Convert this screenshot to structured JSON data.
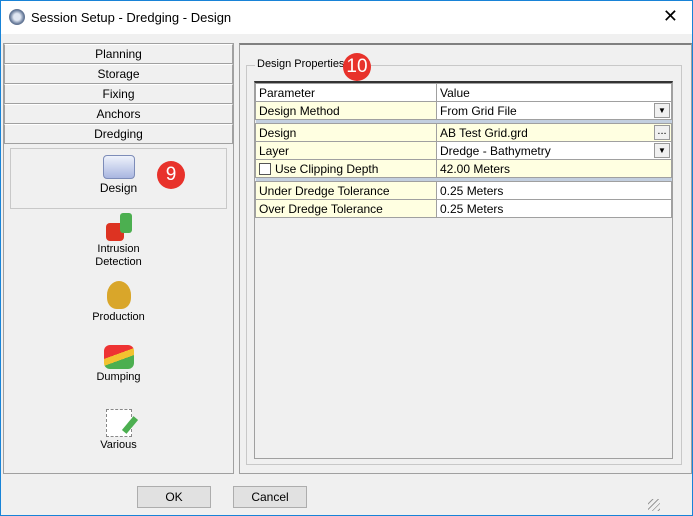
{
  "window": {
    "title": "Session Setup - Dredging -  Design",
    "close": "✕"
  },
  "nav": {
    "tabs": [
      "Planning",
      "Storage",
      "Fixing",
      "Anchors",
      "Dredging"
    ],
    "tools": [
      {
        "label": "Design"
      },
      {
        "label": "Intrusion Detection"
      },
      {
        "label": "Production"
      },
      {
        "label": "Dumping"
      },
      {
        "label": "Various"
      }
    ]
  },
  "badges": {
    "left": "9",
    "right": "10"
  },
  "group": {
    "title": "Design Properties"
  },
  "grid": {
    "headers": [
      "Parameter",
      "Value"
    ],
    "rows": [
      {
        "param": "Design Method",
        "value": "From Grid File"
      },
      {
        "param": "Design",
        "value": "AB Test Grid.grd",
        "button": "..."
      },
      {
        "param": "Layer",
        "value": "Dredge - Bathymetry"
      },
      {
        "param": "Use Clipping Depth",
        "value": "42.00 Meters",
        "checked": false
      },
      {
        "param": "Under Dredge Tolerance",
        "value": "0.25 Meters"
      },
      {
        "param": "Over Dredge Tolerance",
        "value": "0.25 Meters"
      }
    ]
  },
  "buttons": {
    "ok": "OK",
    "cancel": "Cancel"
  }
}
